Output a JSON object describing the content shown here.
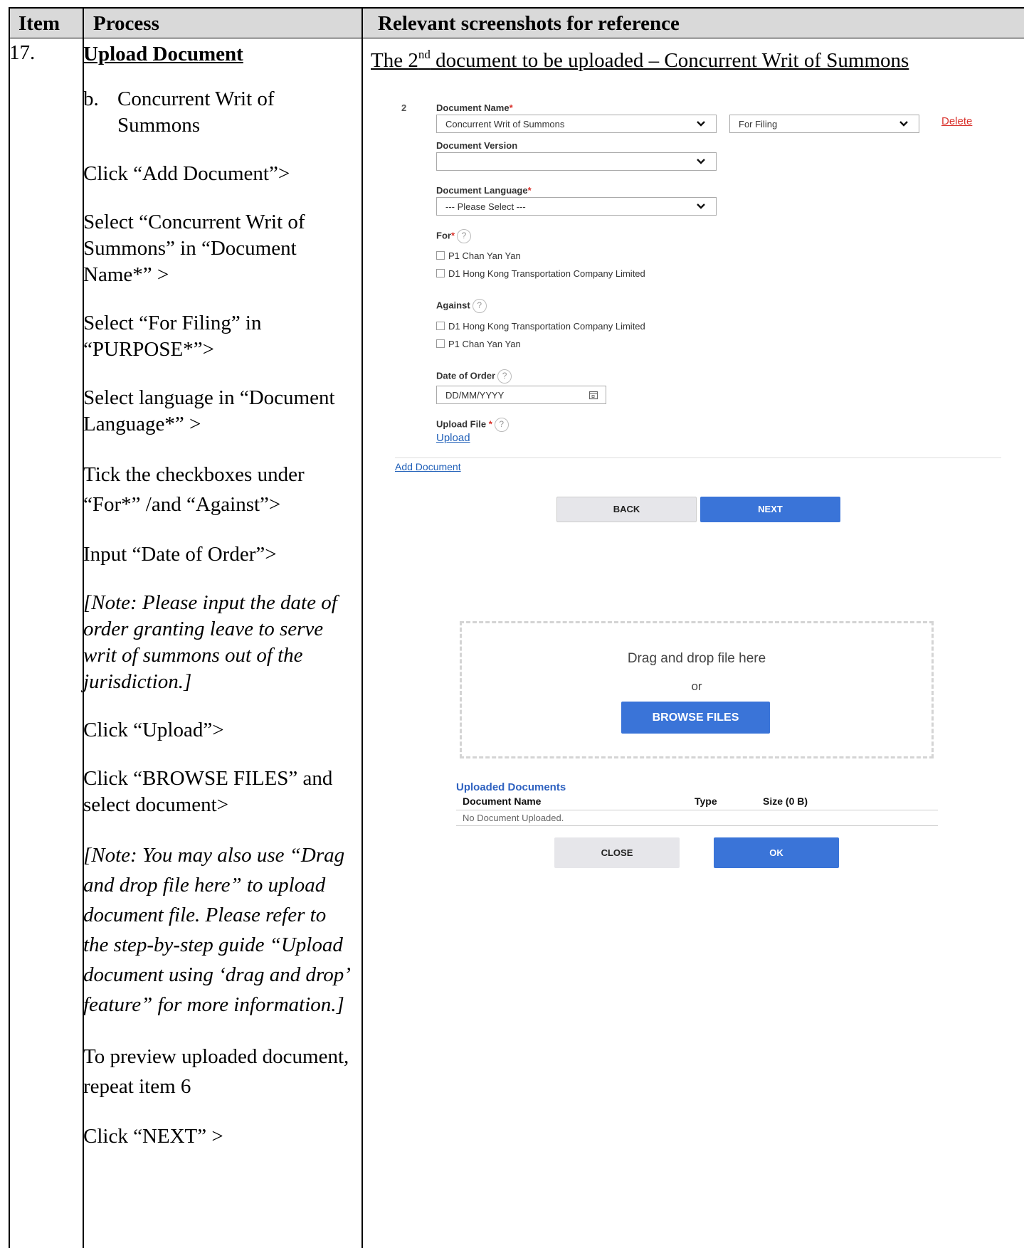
{
  "headers": {
    "item": "Item",
    "process": "Process",
    "reference": "Relevant screenshots for reference"
  },
  "item_number": "17.",
  "process": {
    "title": "Upload Document",
    "sub_label": "b.",
    "sub_text": "Concurrent Writ of Summons",
    "step1": "Click “Add Document”>",
    "step2": "Select “Concurrent Writ of Summons” in “Document Name*” >",
    "step3": "Select “For Filing” in “PURPOSE*”>",
    "step4": "Select language in “Document Language*” >",
    "step5": "Tick the checkboxes under “For*” /and “Against”>",
    "step6": "Input “Date of Order”>",
    "note1": "[Note: Please input the date of order granting leave to serve writ of summons out of the jurisdiction.]",
    "step7": "Click “Upload”>",
    "step8": "Click “BROWSE FILES” and select document>",
    "note2": "[Note: You may also use “Drag and drop file here” to upload document file. Please refer to the step-by-step guide “Upload document using ‘drag and drop’ feature” for more information.]",
    "step9": "To preview uploaded document, repeat item 6",
    "step10": "Click “NEXT” >"
  },
  "reference": {
    "title_pre": "The 2",
    "title_sup": "nd",
    "title_post": " document to be uploaded – Concurrent Writ of Summons"
  },
  "form": {
    "row_number": "2",
    "doc_name_label": "Document Name",
    "doc_name_value": "Concurrent Writ of Summons",
    "purpose_value": "For Filing",
    "delete_link": "Delete",
    "doc_version_label": "Document Version",
    "doc_version_value": "",
    "doc_lang_label": "Document Language",
    "doc_lang_value": "--- Please Select ---",
    "for_label": "For",
    "for_options": [
      "P1 Chan Yan Yan",
      "D1 Hong Kong Transportation Company Limited"
    ],
    "against_label": "Against",
    "against_options": [
      "D1 Hong Kong Transportation Company Limited",
      "P1 Chan Yan Yan"
    ],
    "date_label": "Date of Order",
    "date_placeholder": "DD/MM/YYYY",
    "upload_file_label": "Upload File",
    "upload_link": "Upload",
    "add_document_link": "Add Document",
    "back_button": "BACK",
    "next_button": "NEXT",
    "required_mark": "*",
    "help_mark": "?"
  },
  "upload_dialog": {
    "drag_text": "Drag and drop file here",
    "or_text": "or",
    "browse_button": "BROWSE FILES",
    "uploaded_title": "Uploaded Documents",
    "col_name": "Document Name",
    "col_type": "Type",
    "col_size": "Size (0 B)",
    "empty_text": "No Document Uploaded.",
    "close_button": "CLOSE",
    "ok_button": "OK"
  }
}
